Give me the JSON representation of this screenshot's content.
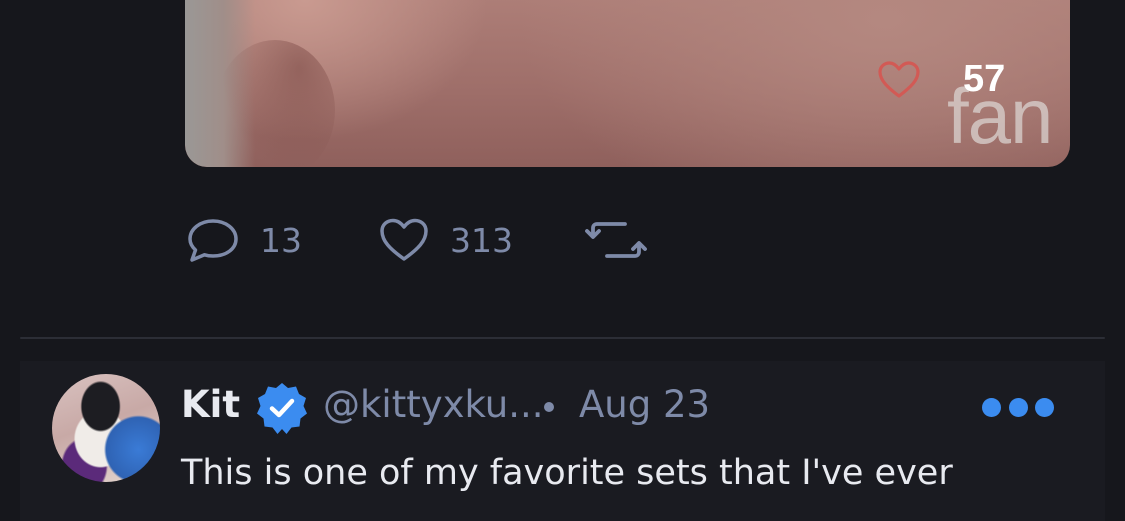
{
  "media": {
    "like_count": "57",
    "watermark_text": "fan",
    "like_icon": "heart-outline-icon"
  },
  "actions": {
    "reply": {
      "icon": "comment-icon",
      "count": "13"
    },
    "like": {
      "icon": "heart-icon",
      "count": "313"
    },
    "repost": {
      "icon": "repost-icon"
    }
  },
  "next_post": {
    "display_name": "Kit",
    "verified_icon": "verified-badge-icon",
    "handle": "@kittyxku...",
    "separator": "•",
    "date": "Aug 23",
    "more_icon": "more-options-icon",
    "text": "This is one of my favorite sets that I've ever"
  },
  "colors": {
    "background": "#16171c",
    "muted_text": "#7e8aa8",
    "primary_text": "#e8eaf0",
    "accent_blue": "#3b8cf0",
    "heart_red": "#d9534f"
  }
}
